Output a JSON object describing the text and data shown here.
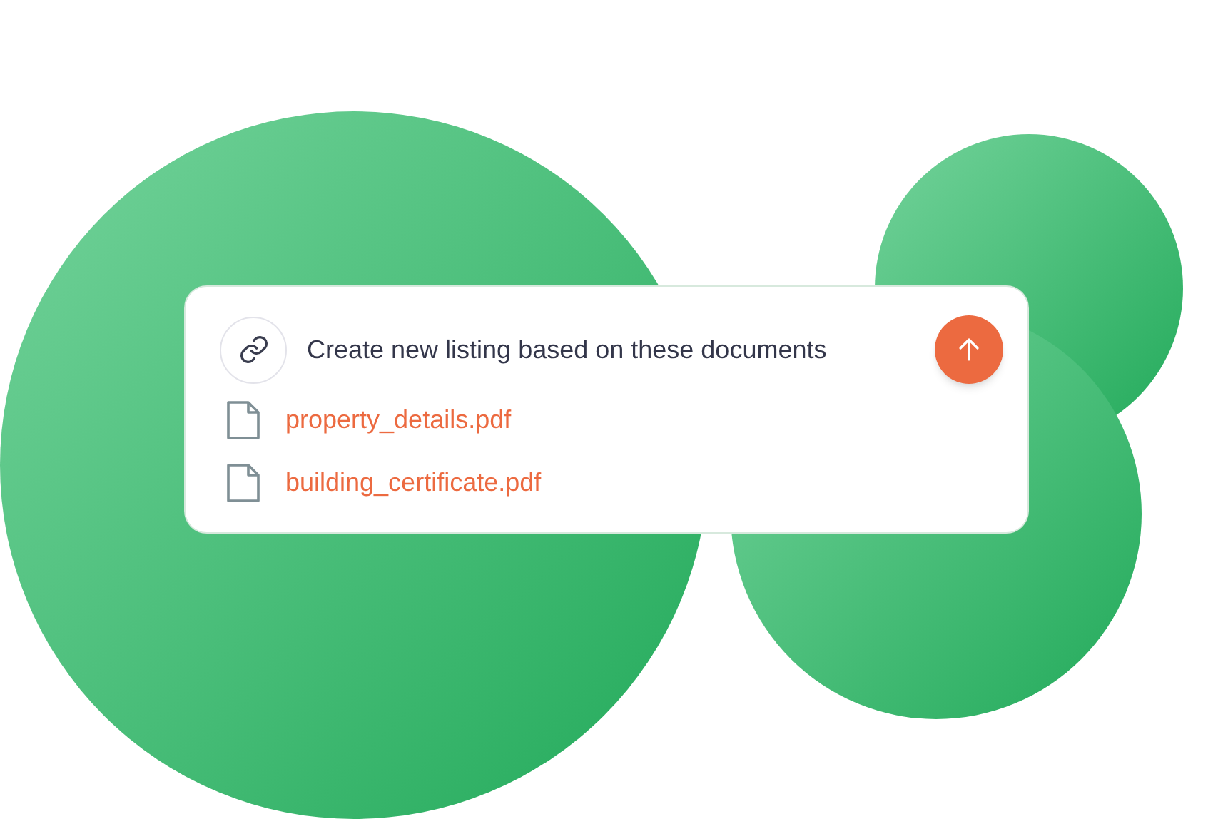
{
  "prompt": {
    "text": "Create new listing based on these documents"
  },
  "attachments": [
    {
      "name": "property_details.pdf"
    },
    {
      "name": "building_certificate.pdf"
    }
  ]
}
